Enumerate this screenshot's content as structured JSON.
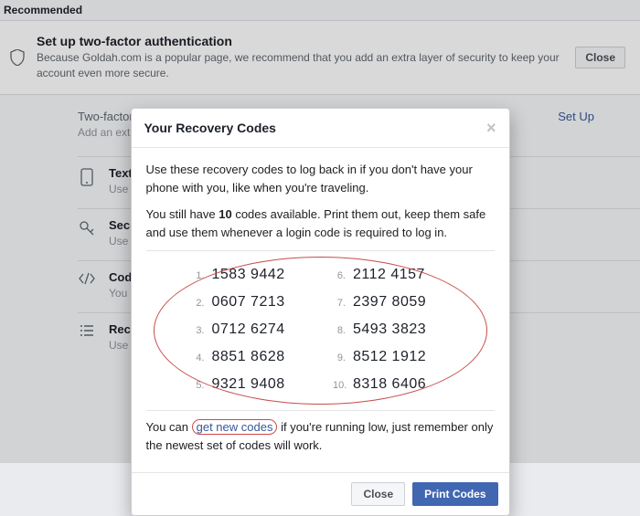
{
  "page": {
    "recommended_label": "Recommended",
    "banner": {
      "title": "Set up two-factor authentication",
      "desc": "Because Goldah.com is a popular page, we recommend that you add an extra layer of security to keep your account even more secure.",
      "close": "Close"
    },
    "status": {
      "text": "Two-factor authentication is off",
      "setup": "Set Up"
    },
    "status_sub": "Add an extra layer of security to keep your account safe.",
    "items": [
      {
        "title": "Text Messages",
        "desc": "Use a login code sent to your phone from login."
      },
      {
        "title": "Security Key",
        "desc": "Use a security key or NFC device."
      },
      {
        "title": "Code Generator",
        "desc": "You can use a code generator on your phone."
      },
      {
        "title": "Recovery Codes",
        "desc": "Use these codes when you don't have your phone."
      }
    ]
  },
  "modal": {
    "title": "Your Recovery Codes",
    "p1": "Use these recovery codes to log back in if you don't have your phone with you, like when you're traveling.",
    "p2_a": "You still have ",
    "p2_count": "10",
    "p2_b": " codes available. Print them out, keep them safe and use them whenever a login code is required to log in.",
    "codes": [
      "1583 9442",
      "0607 7213",
      "0712 6274",
      "8851 8628",
      "9321 9408",
      "2112 4157",
      "2397 8059",
      "5493 3823",
      "8512 1912",
      "8318 6406"
    ],
    "p3_a": "You can ",
    "p3_link": "get new codes",
    "p3_b": " if you're running low, just remember only the newest set of codes will work.",
    "close": "Close",
    "print": "Print Codes"
  }
}
